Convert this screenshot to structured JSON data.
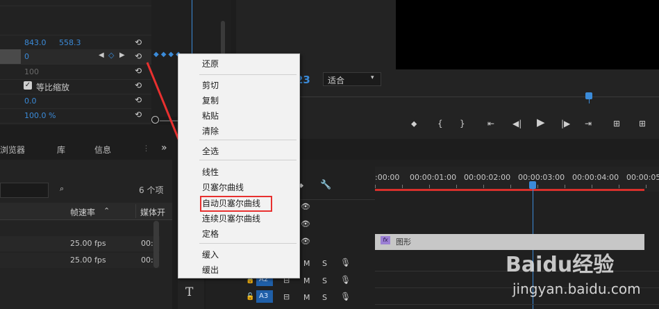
{
  "effect_controls": {
    "row1": {
      "v1": "843.0",
      "v2": "558.3"
    },
    "row2": {
      "v1": "0"
    },
    "row3": {
      "v1": "100"
    },
    "row4": {
      "checkbox_label": "等比缩放"
    },
    "row5": {
      "v1": "0.0"
    },
    "row6": {
      "v1": "100.0 %"
    }
  },
  "program": {
    "timecode_fragment": "23",
    "fit_select": "适合"
  },
  "project_panel": {
    "tabs": [
      "浏览器",
      "库",
      "信息"
    ],
    "more": "»",
    "item_count": "6 个项",
    "col_framerate": "帧速率",
    "col_media": "媒体开",
    "rows": [
      {
        "fps": "25.00 fps",
        "media": "00:"
      },
      {
        "fps": "25.00 fps",
        "media": "00:"
      }
    ]
  },
  "timeline": {
    "ruler": [
      ":00:00",
      "00:00:01:00",
      "00:00:02:00",
      "00:00:03:00",
      "00:00:04:00",
      "00:00:05:0"
    ],
    "clip_label": "图形",
    "tracks": [
      {
        "name": "A2",
        "m": "M",
        "s": "S"
      },
      {
        "name": "A3",
        "m": "M",
        "s": "S"
      }
    ],
    "track1_m": "M",
    "track1_s": "S"
  },
  "context_menu": {
    "items_group1": [
      "还原"
    ],
    "items_group2": [
      "剪切",
      "复制",
      "粘贴",
      "清除"
    ],
    "items_group3": [
      "全选"
    ],
    "items_group4": [
      "线性",
      "贝塞尔曲线",
      "自动贝塞尔曲线",
      "连续贝塞尔曲线",
      "定格"
    ],
    "items_group5": [
      "缓入",
      "缓出"
    ],
    "highlighted": "自动贝塞尔曲线"
  },
  "watermark": {
    "brand": "Baidu经验",
    "url": "jingyan.baidu.com"
  },
  "colors": {
    "accent_blue": "#3b8bd9",
    "arrow_red": "#e8302f",
    "timeline_red": "#d9302b"
  }
}
